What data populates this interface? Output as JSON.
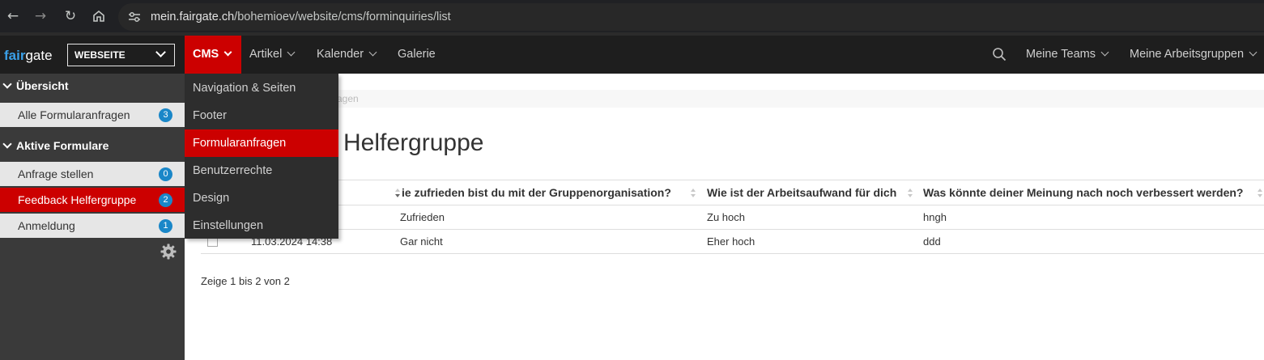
{
  "browser": {
    "url_host": "mein.fairgate.ch",
    "url_path": "/bohemioev/website/cms/forminquiries/list"
  },
  "app": {
    "logo_part1": "fair",
    "logo_part2": "gate",
    "site_selector": "WEBSEITE",
    "nav": {
      "cms": "CMS",
      "artikel": "Artikel",
      "kalender": "Kalender",
      "galerie": "Galerie",
      "meine_teams": "Meine Teams",
      "meine_arbeitsgruppen": "Meine Arbeitsgruppen"
    }
  },
  "dropdown": {
    "items": [
      "Navigation & Seiten",
      "Footer",
      "Formularanfragen",
      "Benutzerrechte",
      "Design",
      "Einstellungen"
    ],
    "active": "Formularanfragen"
  },
  "sidebar": {
    "section1": "Übersicht",
    "all_inquiries": {
      "label": "Alle Formularanfragen",
      "count": "3"
    },
    "section2": "Aktive Formulare",
    "forms": [
      {
        "label": "Anfrage stellen",
        "count": "0"
      },
      {
        "label": "Feedback Helfergruppe",
        "count": "2",
        "active": true
      },
      {
        "label": "Anmeldung",
        "count": "1"
      }
    ]
  },
  "main": {
    "breadcrumb_visible": "agen",
    "title_visible": "Helfergruppe",
    "table": {
      "columns": [
        "ie zufrieden bist du mit der Gruppenorganisation?",
        "Wie ist der Arbeitsaufwand für dich",
        "Was könnte deiner Meinung nach noch verbessert werden?"
      ],
      "rows": [
        {
          "date": "",
          "q1": "Zufrieden",
          "q2": "Zu hoch",
          "q3": "hngh"
        },
        {
          "date": "11.03.2024 14:38",
          "q1": "Gar nicht",
          "q2": "Eher hoch",
          "q3": "ddd"
        }
      ]
    },
    "footer_info": "Zeige 1 bis 2 von 2"
  }
}
